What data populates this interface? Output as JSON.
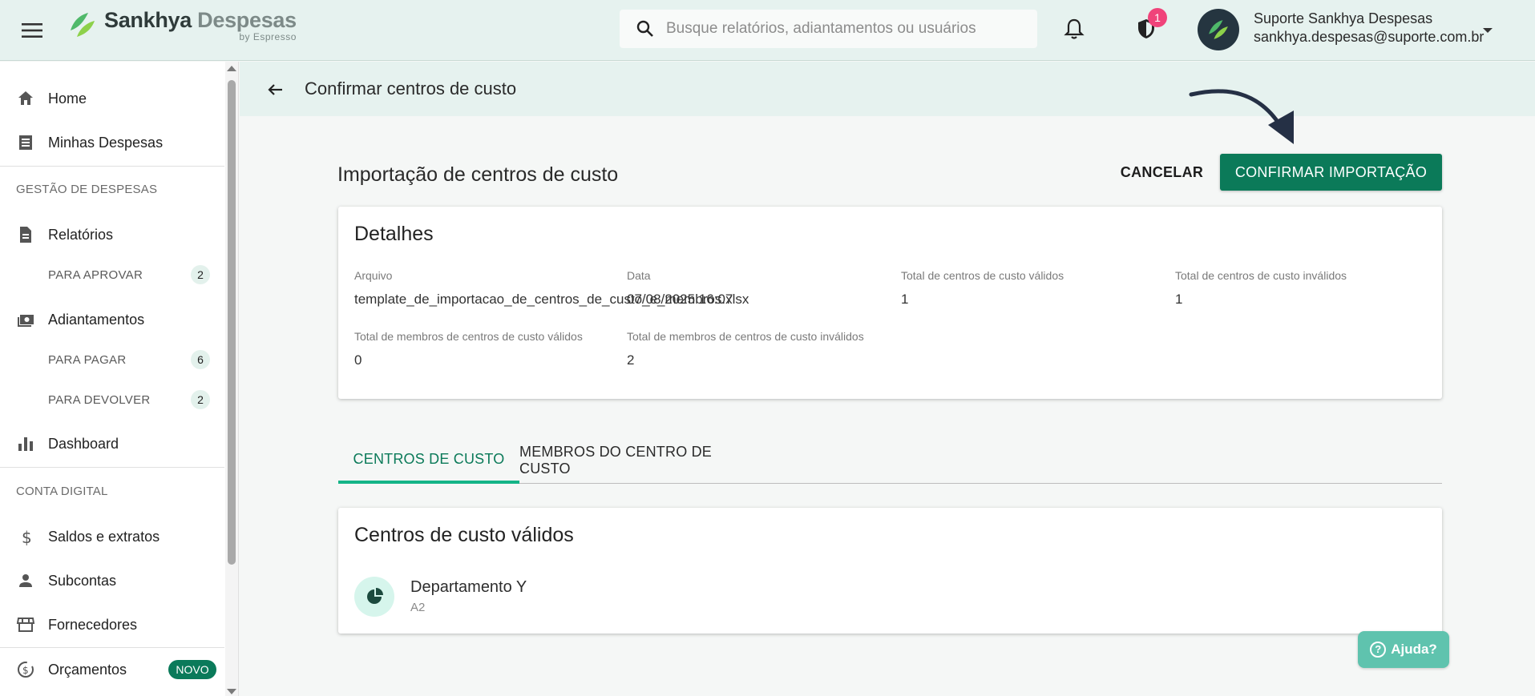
{
  "brand": {
    "name": "Sankhya",
    "name_suffix": "Despesas",
    "tagline": "by Espresso",
    "accent": "#0b7a59"
  },
  "search": {
    "placeholder": "Busque relatórios, adiantamentos ou usuários",
    "value": ""
  },
  "notifications": {
    "shield_count": "1"
  },
  "user": {
    "name": "Suporte Sankhya Despesas",
    "email": "sankhya.despesas@suporte.com.br"
  },
  "sidebar": {
    "home": "Home",
    "minhas_despesas": "Minhas Despesas",
    "section_gestao": "GESTÃO DE DESPESAS",
    "relatorios": "Relatórios",
    "para_aprovar": {
      "label": "PARA APROVAR",
      "count": "2"
    },
    "adiantamentos": "Adiantamentos",
    "para_pagar": {
      "label": "PARA PAGAR",
      "count": "6"
    },
    "para_devolver": {
      "label": "PARA DEVOLVER",
      "count": "2"
    },
    "dashboard": "Dashboard",
    "section_conta": "CONTA DIGITAL",
    "saldos": "Saldos e extratos",
    "subcontas": "Subcontas",
    "fornecedores": "Fornecedores",
    "orcamentos": "Orçamentos",
    "novo_badge": "NOVO"
  },
  "page": {
    "title": "Confirmar centros de custo",
    "section_title": "Importação de centros de custo",
    "cancel_label": "CANCELAR",
    "confirm_label": "CONFIRMAR IMPORTAÇÃO"
  },
  "details": {
    "title": "Detalhes",
    "arquivo": {
      "label": "Arquivo",
      "value": "template_de_importacao_de_centros_de_custo_e_membros.xlsx"
    },
    "data": {
      "label": "Data",
      "value": "07/08/2025 16:07"
    },
    "validos": {
      "label": "Total de centros de custo válidos",
      "value": "1"
    },
    "invalidos": {
      "label": "Total de centros de custo inválidos",
      "value": "1"
    },
    "membros_validos": {
      "label": "Total de membros de centros de custo válidos",
      "value": "0"
    },
    "membros_invalidos": {
      "label": "Total de membros de centros de custo inválidos",
      "value": "2"
    }
  },
  "tabs": {
    "active": "CENTROS DE CUSTO",
    "inactive": "MEMBROS DO CENTRO DE CUSTO"
  },
  "list": {
    "title": "Centros de custo válidos",
    "items": [
      {
        "name": "Departamento Y",
        "code": "A2"
      }
    ]
  },
  "help": {
    "label": "Ajuda?"
  },
  "icons": {
    "menu": "menu-icon",
    "search": "search-icon",
    "bell": "bell-icon",
    "shield": "shield-icon",
    "back": "arrow-back-icon",
    "home": "home-icon",
    "receipt": "receipt-icon",
    "doc": "document-icon",
    "cash": "cash-icon",
    "bar": "bar-chart-icon",
    "dollar": "dollar-icon",
    "person": "person-icon",
    "store": "store-icon",
    "budget": "budget-icon",
    "pie": "pie-icon",
    "help": "help-icon"
  }
}
